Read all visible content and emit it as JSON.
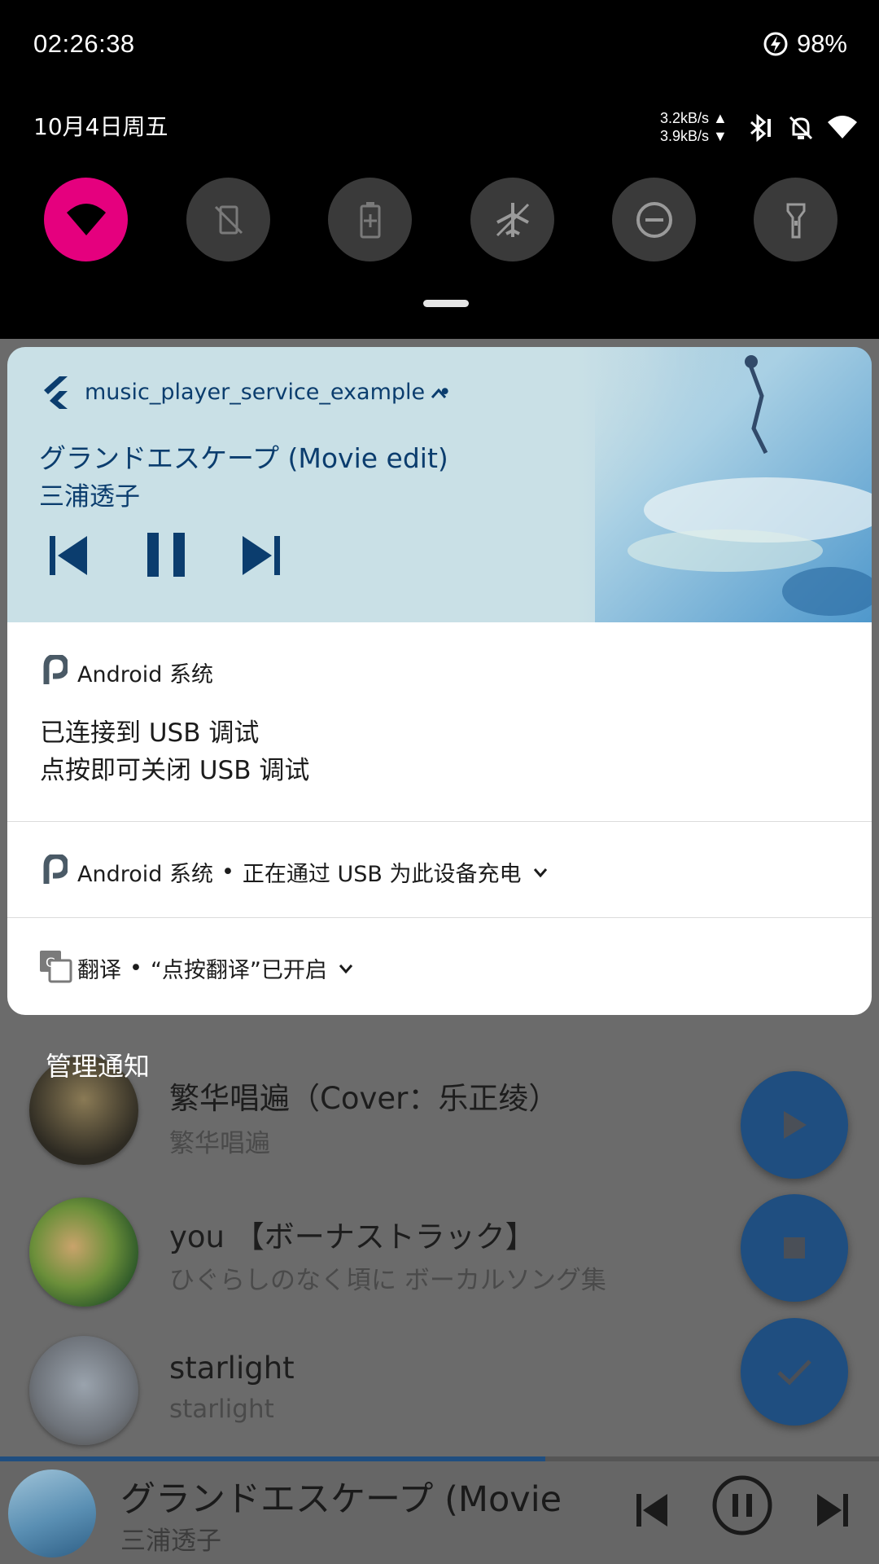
{
  "status_bar": {
    "time": "02:26:38",
    "battery": "98%",
    "date": "10月4日周五",
    "net_up": "3.2kB/s",
    "net_down": "3.9kB/s"
  },
  "quick_settings": {
    "tiles": [
      {
        "icon": "wifi-icon",
        "active": true,
        "color": "#e5007e"
      },
      {
        "icon": "auto-rotate-off-icon",
        "active": false
      },
      {
        "icon": "battery-saver-icon",
        "active": false
      },
      {
        "icon": "airplane-mode-off-icon",
        "active": false
      },
      {
        "icon": "do-not-disturb-icon",
        "active": false
      },
      {
        "icon": "flashlight-icon",
        "active": false
      }
    ]
  },
  "media_notification": {
    "app_name": "music_player_service_example",
    "separator": "•",
    "title": "グランドエスケープ (Movie edit)",
    "artist": "三浦透子",
    "accent_color": "#0b3d6e"
  },
  "notifications": [
    {
      "app": "Android 系统",
      "line1": "已连接到 USB 调试",
      "line2": "点按即可关闭 USB 调试"
    },
    {
      "app": "Android 系统",
      "summary": "正在通过 USB 为此设备充电"
    },
    {
      "app": "翻译",
      "summary": "“点按翻译”已开启"
    }
  ],
  "manage_label": "管理通知",
  "background_app": {
    "songs": [
      {
        "title": "繁华唱遍（Cover：乐正绫）",
        "subtitle": "繁华唱遍"
      },
      {
        "title": "you 【ボーナストラック】",
        "subtitle": "ひぐらしのなく頃に ボーカルソング集"
      },
      {
        "title": "starlight",
        "subtitle": "starlight"
      }
    ],
    "fab_icons": [
      "play-icon",
      "stop-icon",
      "check-icon"
    ],
    "now_playing": {
      "title": "グランドエスケープ (Movie",
      "artist": "三浦透子",
      "progress": 0.62
    }
  }
}
